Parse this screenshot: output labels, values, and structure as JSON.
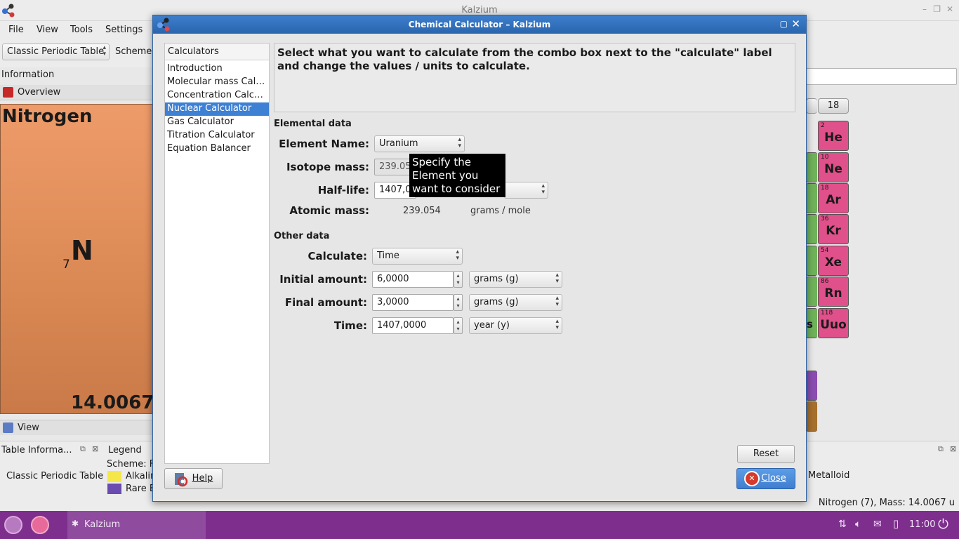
{
  "window": {
    "title": "Kalzium",
    "menu": [
      "File",
      "View",
      "Tools",
      "Settings"
    ],
    "table_combo": "Classic Periodic Table",
    "scheme_combo": "Scheme"
  },
  "info_panel": {
    "label": "Information",
    "overview_tab": "Overview",
    "element_name": "Nitrogen",
    "atomic_number": "7",
    "symbol": "N",
    "mass": "14.0067",
    "view_tab": "View"
  },
  "periodic_table": {
    "group_header": "18",
    "noble_gases": [
      {
        "z": "2",
        "s": "He"
      },
      {
        "z": "10",
        "s": "Ne"
      },
      {
        "z": "18",
        "s": "Ar"
      },
      {
        "z": "36",
        "s": "Kr"
      },
      {
        "z": "54",
        "s": "Xe"
      },
      {
        "z": "86",
        "s": "Rn"
      },
      {
        "z": "118",
        "s": "Uuo"
      }
    ],
    "partial_symbol": "s"
  },
  "docks": {
    "table_info_title": "Table Informa...",
    "table_info_value": "Classic Periodic Table",
    "legend_title": "Legend",
    "legend_scheme": "Scheme: Fa",
    "legend_items": [
      "Alkalin",
      "Rare E"
    ],
    "legend_right": "Metalloid"
  },
  "status": {
    "text": "Nitrogen (7), Mass: 14.0067 u"
  },
  "dialog": {
    "title": "Chemical Calculator – Kalzium",
    "list_header": "Calculators",
    "list_items": [
      "Introduction",
      "Molecular mass Calcu...",
      "Concentration Calcul...",
      "Nuclear Calculator",
      "Gas Calculator",
      "Titration Calculator",
      "Equation Balancer"
    ],
    "selected_index": 3,
    "description": "Select what you want to calculate from the combo box next to the \"calculate\" label and change the values / units to calculate.",
    "elemental_title": "Elemental data",
    "element_name_label": "Element Name:",
    "element_name_value": "Uranium",
    "isotope_label": "Isotope mass:",
    "isotope_value": "239.054",
    "halflife_label": "Half-life:",
    "halflife_value": "1407,00",
    "atomic_mass_label": "Atomic mass:",
    "atomic_mass_value": "239.054",
    "atomic_mass_unit": "grams / mole",
    "other_title": "Other data",
    "calculate_label": "Calculate:",
    "calculate_value": "Time",
    "initial_label": "Initial amount:",
    "initial_value": "6,0000",
    "initial_unit": "grams (g)",
    "final_label": "Final amount:",
    "final_value": "3,0000",
    "final_unit": "grams (g)",
    "time_label": "Time:",
    "time_value": "1407,0000",
    "time_unit": "year (y)",
    "tooltip": "Specify the Element you want to consider",
    "reset": "Reset",
    "help": "Help",
    "close": "Close"
  },
  "panel": {
    "task": "Kalzium",
    "clock": "11:00"
  },
  "colors": {
    "accent": "#3d80d4",
    "dialog_title": "#2a65ad",
    "nitrogen": "#e8935f",
    "noble": "#e0508a",
    "panel": "#7e2f8e"
  }
}
